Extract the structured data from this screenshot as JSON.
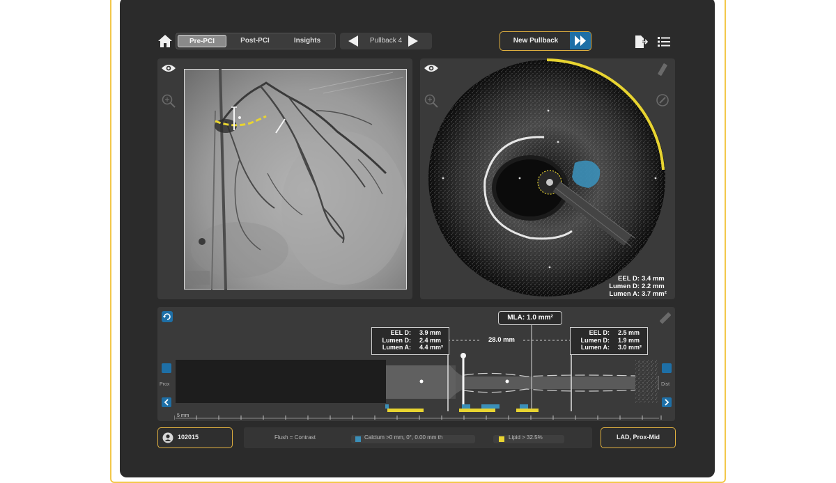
{
  "toolbar": {
    "tabs": [
      {
        "label": "Pre-PCI",
        "active": true
      },
      {
        "label": "Post-PCI",
        "active": false
      },
      {
        "label": "Insights",
        "active": false
      }
    ],
    "pullback_label": "Pullback 4",
    "new_pullback_label": "New Pullback"
  },
  "oct": {
    "eel_d_label": "EEL D:",
    "eel_d_value": "3.4 mm",
    "lumen_d_label": "Lumen D:",
    "lumen_d_value": "2.2 mm",
    "lumen_a_label": "Lumen A:",
    "lumen_a_value": "3.7 mm²"
  },
  "longitudinal": {
    "left_ref": {
      "eel_d": "3.9 mm",
      "lumen_d": "2.4 mm",
      "lumen_a": "4.4 mm²"
    },
    "right_ref": {
      "eel_d": "2.5 mm",
      "lumen_d": "1.9 mm",
      "lumen_a": "3.0 mm²"
    },
    "labels": {
      "eel_d": "EEL D:",
      "lumen_d": "Lumen D:",
      "lumen_a": "Lumen A:"
    },
    "length": "28.0 mm",
    "mla": "MLA: 1.0 mm²",
    "scale": "5 mm",
    "prox": "Prox",
    "dist": "Dist"
  },
  "footer": {
    "patient_id": "102015",
    "flush": "Flush = Contrast",
    "calcium": "Calcium >0 mm, 0°, 0.00 mm th",
    "lipid": "Lipid > 32.5%",
    "vessel": "LAD, Prox-Mid"
  },
  "colors": {
    "accent_yellow": "#e8d431",
    "calcium_blue": "#3b8fb8",
    "button_blue": "#1e6fa6",
    "panel": "#3a3a3a",
    "outline_gold": "#e0b040"
  }
}
